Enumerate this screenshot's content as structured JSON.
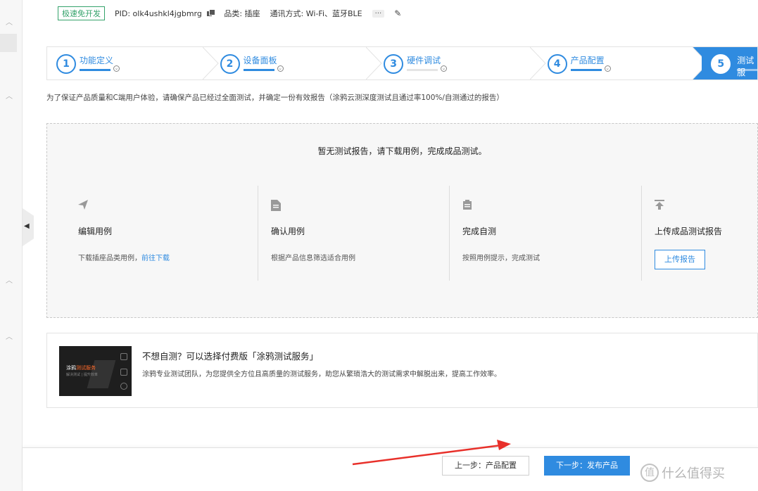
{
  "topbar": {
    "badge": "极速免开发",
    "pid": "PID: olk4ushkl4jgbmrg",
    "category": "品类: 插座",
    "comm": "通讯方式: Wi-Fi、蓝牙BLE",
    "more": "···"
  },
  "steps": [
    {
      "num": "1",
      "title": "功能定义"
    },
    {
      "num": "2",
      "title": "设备面板"
    },
    {
      "num": "3",
      "title": "硬件调试"
    },
    {
      "num": "4",
      "title": "产品配置"
    },
    {
      "num": "5",
      "title": "测试服"
    }
  ],
  "notice": "为了保证产品质量和C端用户体验，请确保产品已经过全面测试，并确定一份有效报告（涂鸦云测深度测试且通过率100%/自测通过的报告）",
  "test_box": {
    "empty_message": "暂无测试报告，请下载用例，完成成品测试。",
    "columns": [
      {
        "icon": "send-icon",
        "title": "编辑用例",
        "desc": "下载插座品类用例，",
        "link": "前往下载"
      },
      {
        "icon": "document-icon",
        "title": "确认用例",
        "desc": "根据产品信息筛选适合用例"
      },
      {
        "icon": "clipboard-icon",
        "title": "完成自测",
        "desc": "按照用例提示，完成测试"
      },
      {
        "icon": "upload-icon",
        "title": "上传成品测试报告",
        "button": "上传报告"
      }
    ]
  },
  "service": {
    "thumb_title_a": "涂鸦",
    "thumb_title_b": "测试服务",
    "thumb_sub": "解决测试 | 提升效率",
    "title": "不想自测？可以选择付费版「涂鸦测试服务」",
    "desc": "涂鸦专业测试团队，为您提供全方位且高质量的测试服务，助您从繁琐浩大的测试需求中解脱出来，提高工作效率。"
  },
  "footer": {
    "prev": "上一步：产品配置",
    "next": "下一步：发布产品"
  },
  "watermark": {
    "logo": "值",
    "text": "什么值得买"
  },
  "colors": {
    "accent": "#2f8be0",
    "badge_green": "#35a36b",
    "annotation_arrow": "#e8302a"
  }
}
